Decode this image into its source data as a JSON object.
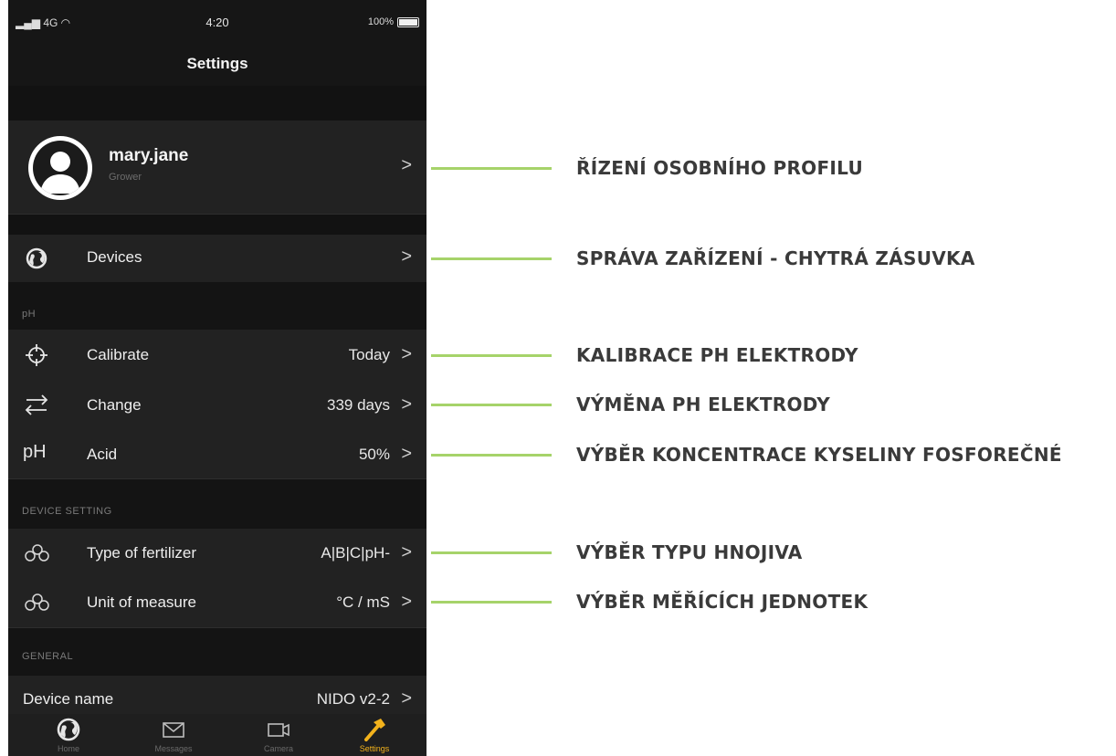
{
  "status_bar": {
    "signal": "4G",
    "time": "4:20",
    "battery": "100%"
  },
  "nav": {
    "title": "Settings"
  },
  "profile": {
    "username": "mary.jane",
    "role": "Grower",
    "chevron": ">"
  },
  "devices": {
    "label": "Devices",
    "chevron": ">",
    "icon": "globe-icon"
  },
  "ph_section": {
    "header": "pH",
    "items": [
      {
        "label": "Calibrate",
        "value": "Today",
        "chevron": ">",
        "icon": "crosshair-icon"
      },
      {
        "label": "Change",
        "value": "339 days",
        "chevron": ">",
        "icon": "swap-arrows-icon"
      },
      {
        "label": "Acid",
        "value": "50%",
        "chevron": ">",
        "icon": "ph-icon",
        "icon_text": "pH"
      }
    ]
  },
  "device_setting": {
    "header": "DEVICE SETTING",
    "items": [
      {
        "label": "Type of fertilizer",
        "value": "A|B|C|pH-",
        "chevron": ">",
        "icon": "molecule-icon"
      },
      {
        "label": "Unit of measure",
        "value": "°C / mS",
        "chevron": ">",
        "icon": "molecule-icon"
      }
    ]
  },
  "general": {
    "header": "GENERAL",
    "items": [
      {
        "label": "Device name",
        "value": "NIDO v2-2",
        "chevron": ">"
      }
    ]
  },
  "tabs": [
    {
      "label": "Home",
      "icon": "globe-icon",
      "active": false
    },
    {
      "label": "Messages",
      "icon": "envelope-icon",
      "active": false
    },
    {
      "label": "Camera",
      "icon": "video-camera-icon",
      "active": false
    },
    {
      "label": "Settings",
      "icon": "hammer-icon",
      "active": true
    }
  ],
  "annotations": [
    "ŘÍZENÍ OSOBNÍHO PROFILU",
    "SPRÁVA ZAŘÍZENÍ - CHYTRÁ ZÁSUVKA",
    "KALIBRACE PH ELEKTRODY",
    "VÝMĚNA PH ELEKTRODY",
    "VÝBĚR KONCENTRACE KYSELINY FOSFOREČNÉ",
    "VÝBĚR TYPU HNOJIVA",
    "VÝBĚR MĚŘÍCÍCH JEDNOTEK"
  ],
  "colors": {
    "accent_line": "#a6d36a",
    "active_tab": "#f2b21c",
    "background": "#121212"
  }
}
